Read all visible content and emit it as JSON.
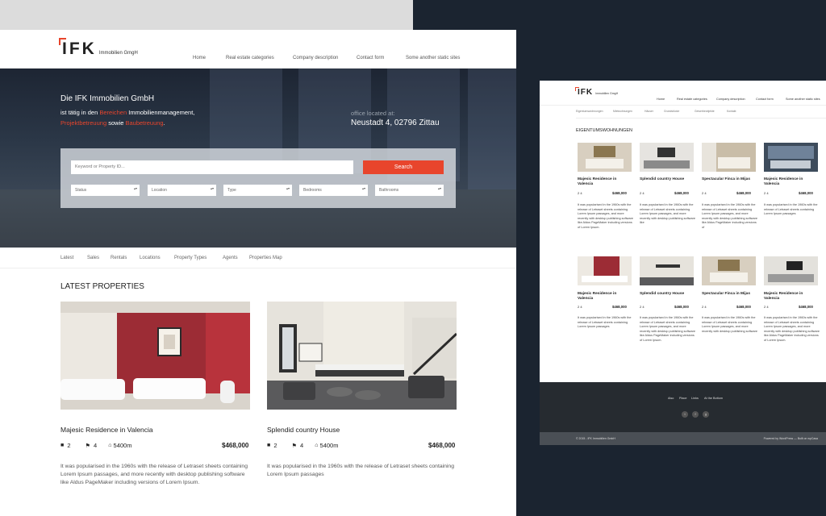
{
  "main": {
    "logo": {
      "mark": "IFK",
      "sub": "Immobilien GmgH"
    },
    "nav": [
      "Home",
      "Real estate categories",
      "Company description",
      "Contact form",
      "Some another static sites"
    ],
    "hero": {
      "title": "Die IFK Immobilien GmbH",
      "line1_a": "ist tätig in den ",
      "line1_red": "Bereichen",
      "line1_b": " Immobilienmanagement,",
      "line2_red1": "Projektbetreuung",
      "line2_mid": " sowie ",
      "line2_red2": "Baubetreuung",
      "line2_end": ".",
      "office_label": "office located at:",
      "office_address": "Neustadt 4, 02796 Zittau"
    },
    "search": {
      "placeholder": "Keyword or Property ID...",
      "button": "Search",
      "filters": [
        "Status",
        "Location",
        "Type",
        "Bedrooms",
        "Bathrooms"
      ]
    },
    "subnav": [
      "Latest",
      "Sales",
      "Rentals",
      "Locations",
      "Property Types",
      "Agents",
      "Properties Map"
    ],
    "latest_heading": "LATEST PROPERTIES",
    "cards": [
      {
        "title": "Majesic Residence in Valencia",
        "beds": "2",
        "baths": "4",
        "area": "5400m",
        "price": "$468,000",
        "desc": " It was popularised in the 1960s with the release of Letraset sheets containing Lorem Ipsum passages, and more recently with desktop publishing software like Aldus PageMaker including versions of Lorem Ipsum."
      },
      {
        "title": "Splendid country House",
        "beds": "2",
        "baths": "4",
        "area": "5400m",
        "price": "$468,000",
        "desc": " It was popularised in the 1960s with the release of Letraset sheets containing Lorem Ipsum passages"
      }
    ]
  },
  "secondary": {
    "logo": {
      "mark": "IFK",
      "sub": "Immobilien GmgH"
    },
    "nav": [
      "Home",
      "Real estate categories",
      "Company description",
      "Contact form",
      "Some another static sites"
    ],
    "subnav": [
      "Eigentumswohnungen",
      "Mietwohnungen",
      "Häuser",
      "Grundstücke",
      "Gewerbeobjekte",
      "Kontakt"
    ],
    "heading": "EIGENTUMSWOHNUNGEN",
    "cards": [
      {
        "title": "Majesic Residence in Valencia",
        "meta": "2  4",
        "price": "$468,000",
        "desc": " It was popularised in the 1960s with the release of Letraset sheets containing Lorem Ipsum passages, and more recently with desktop publishing software like Aldus PageMaker including versions of Lorem Ipsum."
      },
      {
        "title": "Splendid country House",
        "meta": "2  4",
        "price": "$468,000",
        "desc": " It was popularised in the 1960s with the release of Letraset sheets containing Lorem Ipsum passages, and more recently with desktop publishing software like"
      },
      {
        "title": "Spectacular Finca in Mijas",
        "meta": "2  4",
        "price": "$468,000",
        "desc": " It was popularised in the 1960s with the release of Letraset sheets containing Lorem Ipsum passages, and more recently with desktop publishing software like Aldus PageMaker including versions of"
      },
      {
        "title": "Majesic Residence in Valencia",
        "meta": "2  4",
        "price": "$468,000",
        "desc": " It was popularised in the 1960s with the release of Letraset sheets containing Lorem Ipsum passages"
      },
      {
        "title": "Majesic Residence in Valencia",
        "meta": "2  4",
        "price": "$468,000",
        "desc": " It was popularised in the 1960s with the release of Letraset sheets containing Lorem Ipsum passages"
      },
      {
        "title": "Splendid country House",
        "meta": "2  4",
        "price": "$468,000",
        "desc": " It was popularised in the 1960s with the release of Letraset sheets containing Lorem Ipsum passages, and more recently with desktop publishing software like Aldus PageMaker including versions of Lorem Ipsum."
      },
      {
        "title": "Spectacular Finca in Mijas",
        "meta": "2  4",
        "price": "$468,000",
        "desc": " It was popularised in the 1960s with the release of Letraset sheets containing Lorem Ipsum passages, and more recently with desktop publishing software"
      },
      {
        "title": "Majesic Residence in Valencia",
        "meta": "2  4",
        "price": "$468,000",
        "desc": " It was popularised in the 1960s with the release of Letraset sheets containing Lorem Ipsum passages, and more recently with desktop publishing software like Aldus PageMaker including versions of Lorem Ipsum."
      }
    ],
    "footer_nav": [
      "Also",
      "Place",
      "Links",
      "At the Bottom"
    ],
    "social": [
      "t",
      "f",
      "g"
    ],
    "copyright": "© 2015 - IFK Immobilien GmbH",
    "powered": "Powered by WordPress — Built on wpCasa"
  },
  "colors": {
    "accent": "#e8452c",
    "dark_bg": "#1b2430",
    "footer": "#262b30"
  }
}
